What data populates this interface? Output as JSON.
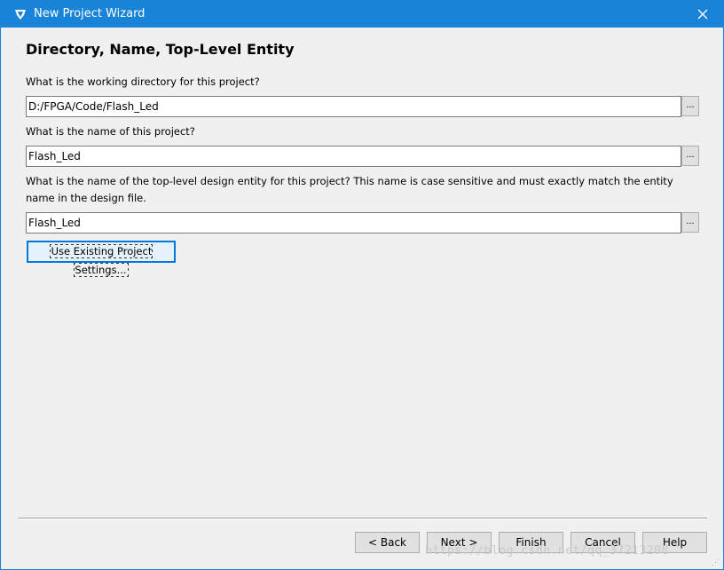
{
  "window": {
    "title": "New Project Wizard",
    "close_glyph": "✕"
  },
  "page": {
    "heading": "Directory, Name, Top-Level Entity"
  },
  "fields": {
    "directory": {
      "label": "What is the working directory for this project?",
      "value": "D:/FPGA/Code/Flash_Led"
    },
    "name": {
      "label": "What is the name of this project?",
      "value": "Flash_Led"
    },
    "entity": {
      "label": "What is the name of the top-level design entity for this project? This name is case sensitive and must exactly match the entity name in the design file.",
      "value": "Flash_Led"
    }
  },
  "browse_label": "...",
  "existing_settings_label": "Use Existing Project Settings...",
  "buttons": {
    "back": "< Back",
    "next": "Next >",
    "finish": "Finish",
    "cancel": "Cancel",
    "help": "Help"
  },
  "watermark": "https://blog.csdn.net/qq_37213208",
  "icons": {
    "app": "quartus-app-icon",
    "close": "close-icon"
  },
  "colors": {
    "titlebar": "#1883d7",
    "focus": "#0078d7"
  }
}
